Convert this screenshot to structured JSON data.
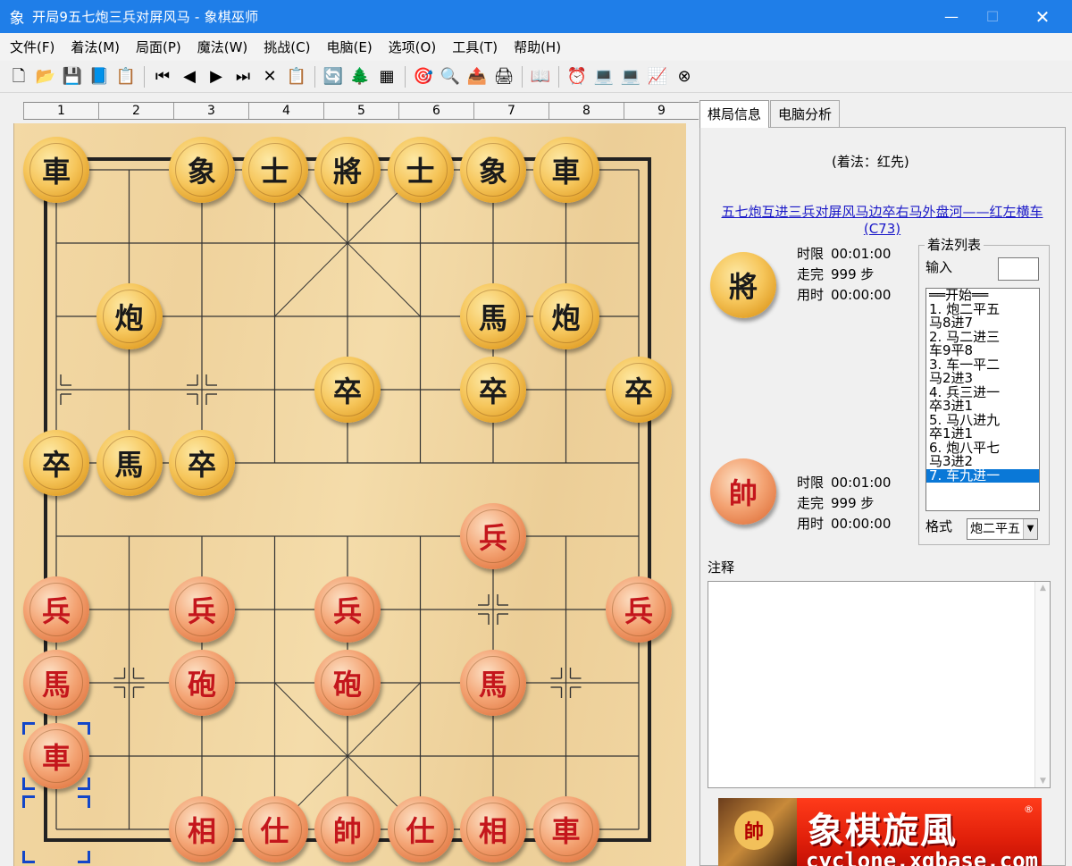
{
  "window": {
    "icon_char": "象",
    "title": "开局9五七炮三兵对屏风马 - 象棋巫师",
    "minimize": "—",
    "maximize": "☐",
    "close": "✕"
  },
  "menu": [
    "文件(F)",
    "着法(M)",
    "局面(P)",
    "魔法(W)",
    "挑战(C)",
    "电脑(E)",
    "选项(O)",
    "工具(T)",
    "帮助(H)"
  ],
  "toolbar": [
    {
      "icon": "new-file-icon",
      "glyph": "🗋"
    },
    {
      "icon": "open-folder-icon",
      "glyph": "📂"
    },
    {
      "icon": "save-icon",
      "glyph": "💾"
    },
    {
      "icon": "book-icon",
      "glyph": "📘"
    },
    {
      "icon": "properties-icon",
      "glyph": "📋"
    },
    {
      "sep": true
    },
    {
      "icon": "first-move-icon",
      "glyph": "⏮"
    },
    {
      "icon": "prev-move-icon",
      "glyph": "◀"
    },
    {
      "icon": "next-move-icon",
      "glyph": "▶"
    },
    {
      "icon": "last-move-icon",
      "glyph": "⏭"
    },
    {
      "icon": "delete-icon",
      "glyph": "✕"
    },
    {
      "icon": "paste-icon",
      "glyph": "📋"
    },
    {
      "sep": true
    },
    {
      "icon": "flip-board-icon",
      "glyph": "🔄"
    },
    {
      "icon": "tree-icon",
      "glyph": "🌲"
    },
    {
      "icon": "grid-icon",
      "glyph": "▦"
    },
    {
      "sep": true
    },
    {
      "icon": "engine-icon",
      "glyph": "🎯"
    },
    {
      "icon": "analyze-icon",
      "glyph": "🔍"
    },
    {
      "icon": "export-icon",
      "glyph": "📤"
    },
    {
      "icon": "print-icon",
      "glyph": "🖨"
    },
    {
      "sep": true
    },
    {
      "icon": "library-icon",
      "glyph": "📖"
    },
    {
      "sep": true
    },
    {
      "icon": "clock-icon",
      "glyph": "⏰"
    },
    {
      "icon": "computer-icon",
      "glyph": "💻"
    },
    {
      "icon": "computer2-icon",
      "glyph": "💻"
    },
    {
      "icon": "monitor-icon",
      "glyph": "📈"
    },
    {
      "icon": "stop-icon",
      "glyph": "⊗"
    }
  ],
  "ruler": [
    "1",
    "2",
    "3",
    "4",
    "5",
    "6",
    "7",
    "8",
    "9"
  ],
  "pieces": [
    {
      "side": "black",
      "char": "車",
      "file": 0,
      "rank": 0
    },
    {
      "side": "black",
      "char": "象",
      "file": 2,
      "rank": 0
    },
    {
      "side": "black",
      "char": "士",
      "file": 3,
      "rank": 0
    },
    {
      "side": "black",
      "char": "將",
      "file": 4,
      "rank": 0
    },
    {
      "side": "black",
      "char": "士",
      "file": 5,
      "rank": 0
    },
    {
      "side": "black",
      "char": "象",
      "file": 6,
      "rank": 0
    },
    {
      "side": "black",
      "char": "車",
      "file": 7,
      "rank": 0
    },
    {
      "side": "black",
      "char": "炮",
      "file": 1,
      "rank": 2
    },
    {
      "side": "black",
      "char": "馬",
      "file": 6,
      "rank": 2
    },
    {
      "side": "black",
      "char": "炮",
      "file": 7,
      "rank": 2
    },
    {
      "side": "black",
      "char": "卒",
      "file": 4,
      "rank": 3
    },
    {
      "side": "black",
      "char": "卒",
      "file": 6,
      "rank": 3
    },
    {
      "side": "black",
      "char": "卒",
      "file": 8,
      "rank": 3
    },
    {
      "side": "black",
      "char": "卒",
      "file": 0,
      "rank": 4
    },
    {
      "side": "black",
      "char": "馬",
      "file": 1,
      "rank": 4
    },
    {
      "side": "black",
      "char": "卒",
      "file": 2,
      "rank": 4
    },
    {
      "side": "red",
      "char": "兵",
      "file": 6,
      "rank": 5
    },
    {
      "side": "red",
      "char": "兵",
      "file": 0,
      "rank": 6
    },
    {
      "side": "red",
      "char": "兵",
      "file": 2,
      "rank": 6
    },
    {
      "side": "red",
      "char": "兵",
      "file": 4,
      "rank": 6
    },
    {
      "side": "red",
      "char": "兵",
      "file": 8,
      "rank": 6
    },
    {
      "side": "red",
      "char": "馬",
      "file": 0,
      "rank": 7
    },
    {
      "side": "red",
      "char": "砲",
      "file": 2,
      "rank": 7
    },
    {
      "side": "red",
      "char": "砲",
      "file": 4,
      "rank": 7
    },
    {
      "side": "red",
      "char": "馬",
      "file": 6,
      "rank": 7
    },
    {
      "side": "red",
      "char": "車",
      "file": 0,
      "rank": 8
    },
    {
      "side": "red",
      "char": "相",
      "file": 2,
      "rank": 9
    },
    {
      "side": "red",
      "char": "仕",
      "file": 3,
      "rank": 9
    },
    {
      "side": "red",
      "char": "帥",
      "file": 4,
      "rank": 9
    },
    {
      "side": "red",
      "char": "仕",
      "file": 5,
      "rank": 9
    },
    {
      "side": "red",
      "char": "相",
      "file": 6,
      "rank": 9
    },
    {
      "side": "red",
      "char": "車",
      "file": 7,
      "rank": 9
    }
  ],
  "last_move": {
    "from_file": 0,
    "from_rank": 9,
    "to_file": 0,
    "to_rank": 8
  },
  "panel": {
    "tabs": [
      "棋局信息",
      "电脑分析"
    ],
    "active_tab": 0,
    "move_side": "(着法：红先)",
    "opening": "五七炮互进三兵对屏风马边卒右马外盘河——红左横车(C73)",
    "black_player": {
      "piece": "將",
      "limit_label": "时限",
      "limit": "00:01:00",
      "moves_label": "走完",
      "moves": "999 步",
      "used_label": "用时",
      "used": "00:00:00"
    },
    "red_player": {
      "piece": "帥",
      "limit_label": "时限",
      "limit": "00:01:00",
      "moves_label": "走完",
      "moves": "999 步",
      "used_label": "用时",
      "used": "00:00:00"
    },
    "movelist_title": "着法列表",
    "input_label": "输入",
    "moves": [
      "══开始══",
      "1. 炮二平五",
      "马8进7",
      "2. 马二进三",
      "车9平8",
      "3. 车一平二",
      "马2进3",
      "4. 兵三进一",
      "卒3进1",
      "5. 马八进九",
      "卒1进1",
      "6. 炮八平七",
      "马3进2",
      "7. 车九进一"
    ],
    "selected_move": 13,
    "format_label": "格式",
    "format_value": "炮二平五",
    "notes_label": "注释",
    "notes_text": ""
  },
  "banner": {
    "title": "象棋旋風",
    "reg": "®",
    "url": "cyclone.xqbase.com",
    "mini_char": "帥"
  },
  "colors": {
    "titlebar": "#1f7ee8",
    "selection": "#1346c8",
    "link": "#1a18c8"
  }
}
